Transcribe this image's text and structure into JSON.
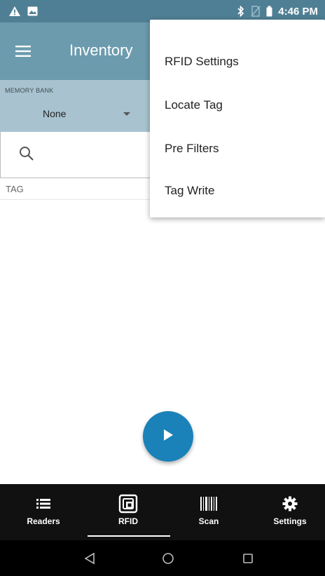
{
  "status_bar": {
    "time": "4:46 PM"
  },
  "app_bar": {
    "title": "Inventory"
  },
  "filter": {
    "memory_bank_label": "MEMORY BANK",
    "memory_bank_value": "None"
  },
  "list": {
    "column_header": "TAG"
  },
  "overflow_menu": {
    "items": [
      {
        "label": "RFID Settings"
      },
      {
        "label": "Locate Tag"
      },
      {
        "label": "Pre Filters"
      },
      {
        "label": "Tag Write"
      }
    ]
  },
  "bottom_nav": {
    "items": [
      {
        "label": "Readers",
        "icon": "list-icon"
      },
      {
        "label": "RFID",
        "icon": "rfid-icon",
        "selected": true
      },
      {
        "label": "Scan",
        "icon": "barcode-icon"
      },
      {
        "label": "Settings",
        "icon": "gear-icon"
      }
    ]
  },
  "colors": {
    "status_bar": "#4f7f94",
    "app_bar": "#6c9bae",
    "filter_bar": "#a8c3cf",
    "fab": "#1a82b8",
    "bottom_nav": "#111111"
  }
}
